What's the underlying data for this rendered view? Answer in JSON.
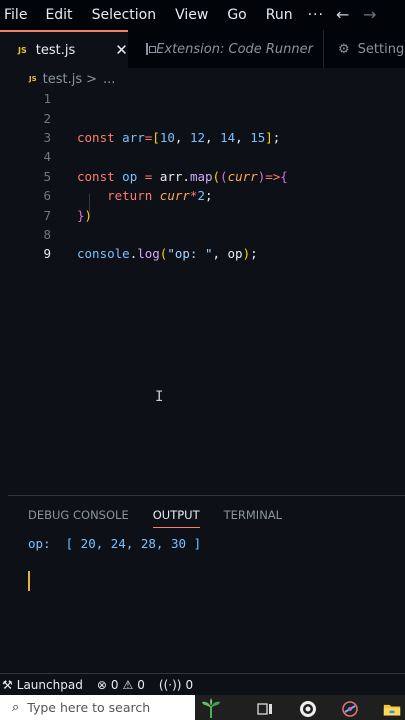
{
  "menubar": {
    "items": [
      "File",
      "Edit",
      "Selection",
      "View",
      "Go",
      "Run"
    ],
    "more": "···",
    "back_icon": "arrow-left-icon",
    "forward_icon": "arrow-right-icon"
  },
  "tabs": [
    {
      "badge": "JS",
      "label": "test.js",
      "close": "✕",
      "active": true
    },
    {
      "label": "Extension: Code Runner",
      "active": false,
      "icon": "extension-preview-icon"
    },
    {
      "label": "Settings",
      "active": false,
      "icon": "gear-icon"
    }
  ],
  "breadcrumb": {
    "badge": "JS",
    "file": "test.js",
    "sep": ">",
    "rest": "..."
  },
  "editor": {
    "line_numbers": [
      "1",
      "2",
      "3",
      "4",
      "5",
      "6",
      "7",
      "8",
      "9"
    ],
    "current_line": "9"
  },
  "panel": {
    "tabs": [
      "DEBUG CONSOLE",
      "OUTPUT",
      "TERMINAL"
    ],
    "active_tab": "OUTPUT",
    "output": "op:  [ 20, 24, 28, 30 ]"
  },
  "statusbar": {
    "launchpad": "Launchpad",
    "errors": "0",
    "warnings": "0",
    "ports": "0"
  },
  "taskbar": {
    "search_placeholder": "Type here to search"
  },
  "colors": {
    "editor_bg": "#0d1117",
    "tab_accent": "#f78166",
    "keyword": "#ff7b72",
    "string": "#a5d6ff",
    "number": "#79c0ff"
  }
}
